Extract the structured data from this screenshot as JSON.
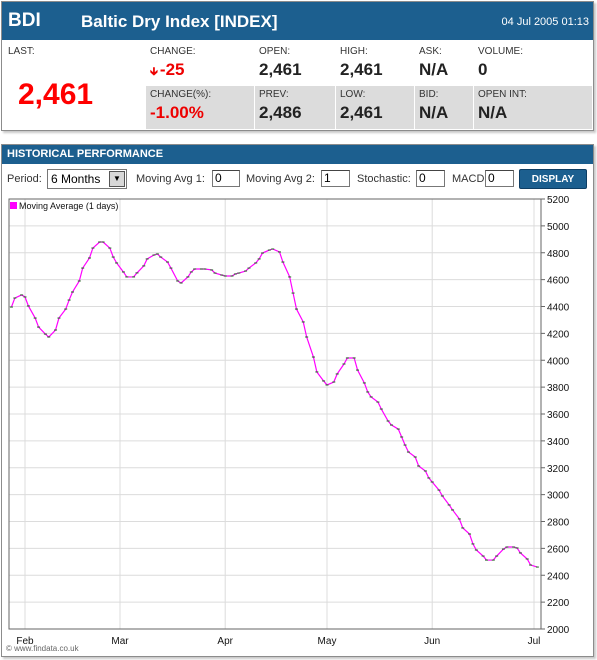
{
  "quote": {
    "symbol": "BDI",
    "name": "Baltic Dry Index [INDEX]",
    "timestamp": "04 Jul 2005 01:13",
    "last_label": "LAST:",
    "last_value": "2,461",
    "change_label": "CHANGE:",
    "change_value": "-25",
    "change_icon": "down-arrow-icon",
    "change_pct_label": "CHANGE(%):",
    "change_pct_value": "-1.00%",
    "open_label": "OPEN:",
    "open_value": "2,461",
    "prev_label": "PREV:",
    "prev_value": "2,486",
    "high_label": "HIGH:",
    "high_value": "2,461",
    "low_label": "LOW:",
    "low_value": "2,461",
    "ask_label": "ASK:",
    "ask_value": "N/A",
    "bid_label": "BID:",
    "bid_value": "N/A",
    "volume_label": "VOLUME:",
    "volume_value": "0",
    "open_int_label": "OPEN INT:",
    "open_int_value": "N/A",
    "colors": {
      "header": "#1c5f8f",
      "negative": "#ee0000",
      "cell_gray": "#dcdcdc"
    }
  },
  "history": {
    "title": "HISTORICAL PERFORMANCE",
    "period_label": "Period:",
    "period_value": "6 Months",
    "ma1_label": "Moving Avg 1:",
    "ma1_value": "0",
    "ma2_label": "Moving Avg 2:",
    "ma2_value": "1",
    "stoch_label": "Stochastic:",
    "stoch_value": "0",
    "macd_label": "MACD",
    "macd_value": "0",
    "display_label": "DISPLAY",
    "copyright": "© www.findata.co.uk"
  },
  "chart_data": {
    "type": "line",
    "title": "",
    "legend": [
      {
        "name": "Moving Average (1 days)",
        "color": "#ff00ff"
      }
    ],
    "legend_position": "top-left",
    "xlabel": "",
    "ylabel": "",
    "x_unit": "days since 2005-02-01",
    "x_ticks": [
      {
        "label": "Feb",
        "x": 0
      },
      {
        "label": "Mar",
        "x": 28
      },
      {
        "label": "Apr",
        "x": 59
      },
      {
        "label": "May",
        "x": 89
      },
      {
        "label": "Jun",
        "x": 120
      },
      {
        "label": "Jul",
        "x": 150
      }
    ],
    "xlim": [
      -5,
      152
    ],
    "ylim": [
      2000,
      5200
    ],
    "y_ticks": [
      2000,
      2200,
      2400,
      2600,
      2800,
      3000,
      3200,
      3400,
      3600,
      3800,
      4000,
      4200,
      4400,
      4600,
      4800,
      5000,
      5200
    ],
    "y_axis_side": "right",
    "grid": true,
    "series": [
      {
        "name": "Moving Average (1 days)",
        "color": "#ff00ff",
        "marker_color": "#1a6a1a",
        "x": [
          -4,
          -3,
          -1,
          0,
          1,
          3,
          4,
          6,
          7,
          9,
          10,
          12,
          13,
          14,
          16,
          17,
          19,
          20,
          22,
          23,
          25,
          26,
          27,
          29,
          30,
          32,
          33,
          35,
          36,
          38,
          39,
          40,
          42,
          43,
          45,
          46,
          48,
          49,
          50,
          52,
          53,
          55,
          56,
          58,
          59,
          61,
          62,
          63,
          65,
          66,
          68,
          69,
          70,
          72,
          73,
          75,
          76,
          78,
          79,
          80,
          82,
          83,
          85,
          86,
          88,
          89,
          91,
          92,
          94,
          95,
          97,
          98,
          100,
          101,
          102,
          104,
          105,
          107,
          108,
          110,
          111,
          112,
          113,
          115,
          116,
          118,
          119,
          120,
          122,
          123,
          125,
          126,
          128,
          129,
          131,
          132,
          133,
          135,
          136,
          138,
          139,
          141,
          142,
          144,
          145,
          146,
          148,
          149,
          151
        ],
        "values": [
          4396,
          4463,
          4486,
          4471,
          4404,
          4314,
          4247,
          4195,
          4173,
          4225,
          4314,
          4381,
          4448,
          4508,
          4590,
          4686,
          4761,
          4835,
          4880,
          4880,
          4835,
          4768,
          4724,
          4657,
          4620,
          4620,
          4650,
          4702,
          4754,
          4783,
          4791,
          4768,
          4731,
          4686,
          4590,
          4575,
          4620,
          4657,
          4679,
          4679,
          4679,
          4672,
          4649,
          4634,
          4627,
          4627,
          4642,
          4649,
          4664,
          4686,
          4724,
          4754,
          4798,
          4820,
          4828,
          4806,
          4731,
          4620,
          4500,
          4381,
          4285,
          4173,
          4024,
          3913,
          3846,
          3816,
          3838,
          3898,
          3972,
          4017,
          4017,
          3927,
          3831,
          3764,
          3727,
          3689,
          3637,
          3548,
          3518,
          3488,
          3429,
          3369,
          3317,
          3280,
          3213,
          3176,
          3124,
          3094,
          3034,
          2990,
          2923,
          2886,
          2819,
          2752,
          2707,
          2633,
          2588,
          2543,
          2513,
          2513,
          2543,
          2595,
          2610,
          2610,
          2603,
          2566,
          2521,
          2476,
          2461
        ]
      }
    ]
  }
}
